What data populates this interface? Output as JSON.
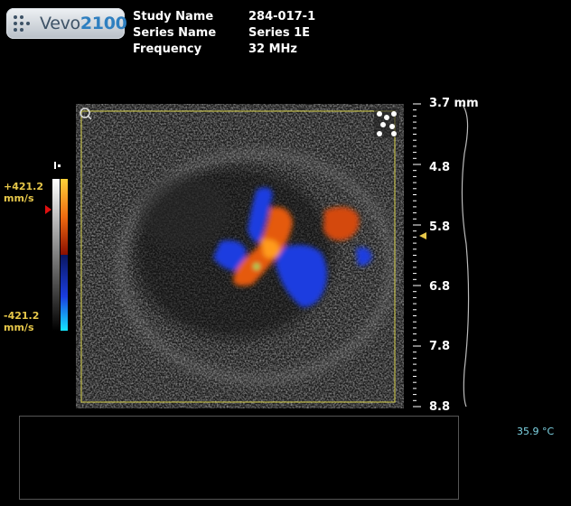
{
  "logo": {
    "brand": "Vevo",
    "model": "2100"
  },
  "study": {
    "study_name_label": "Study Name",
    "study_name_value": "284-017-1",
    "series_name_label": "Series Name",
    "series_name_value": "Series 1E",
    "frequency_label": "Frequency",
    "frequency_value": "32 MHz"
  },
  "velocity": {
    "pos_value": "+421.2",
    "pos_unit": "mm/s",
    "neg_value": "-421.2",
    "neg_unit": "mm/s"
  },
  "depth_scale": {
    "labels": [
      "3.7 mm",
      "4.8",
      "5.8",
      "6.8",
      "7.8",
      "8.8"
    ]
  },
  "temperature": "35.9 °C",
  "colors": {
    "roi_box": "#d8d24a",
    "marker": "#e7c84a",
    "velocity_text": "#e7c84a",
    "temp_text": "#7fd6e6"
  }
}
